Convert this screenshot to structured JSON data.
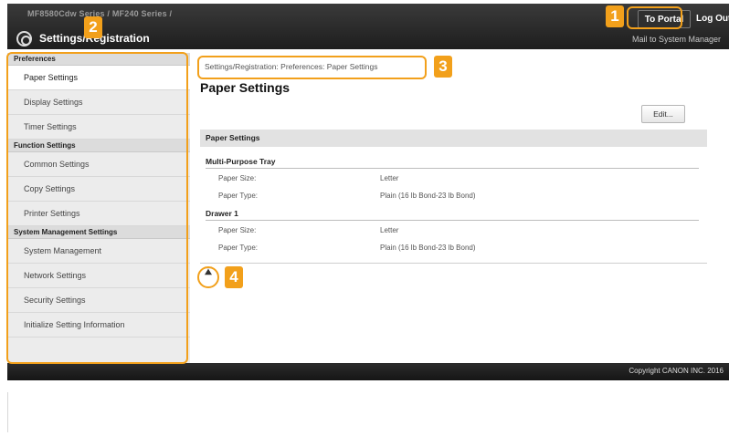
{
  "header": {
    "device_name": "MF8580Cdw Series / MF240 Series /",
    "app_title": "Settings/Registration",
    "to_portal_label": "To Portal",
    "logout_label": "Log Out",
    "mail_link": "Mail to System Manager"
  },
  "sidebar": {
    "sections": [
      {
        "heading": "Preferences",
        "items": [
          "Paper Settings",
          "Display Settings",
          "Timer Settings"
        ]
      },
      {
        "heading": "Function Settings",
        "items": [
          "Common Settings",
          "Copy Settings",
          "Printer Settings"
        ]
      },
      {
        "heading": "System Management Settings",
        "items": [
          "System Management",
          "Network Settings",
          "Security Settings",
          "Initialize Setting Information"
        ]
      }
    ],
    "active_item": "Paper Settings"
  },
  "main": {
    "breadcrumb": "Settings/Registration: Preferences: Paper Settings",
    "page_title": "Paper Settings",
    "edit_label": "Edit...",
    "section_title": "Paper Settings",
    "groups": [
      {
        "title": "Multi-Purpose Tray",
        "rows": [
          {
            "label": "Paper Size:",
            "value": "Letter"
          },
          {
            "label": "Paper Type:",
            "value": "Plain (16 lb Bond-23 lb Bond)"
          }
        ]
      },
      {
        "title": "Drawer 1",
        "rows": [
          {
            "label": "Paper Size:",
            "value": "Letter"
          },
          {
            "label": "Paper Type:",
            "value": "Plain (16 lb Bond-23 lb Bond)"
          }
        ]
      }
    ],
    "top_icon": "move-to-top-icon"
  },
  "footer": {
    "copyright": "Copyright CANON INC. 2016"
  },
  "callouts": [
    "1",
    "2",
    "3",
    "4"
  ],
  "colors": {
    "callout": "#f2a01b",
    "header_bg": "#2a2a2a",
    "sidebar_bg": "#ececec"
  }
}
